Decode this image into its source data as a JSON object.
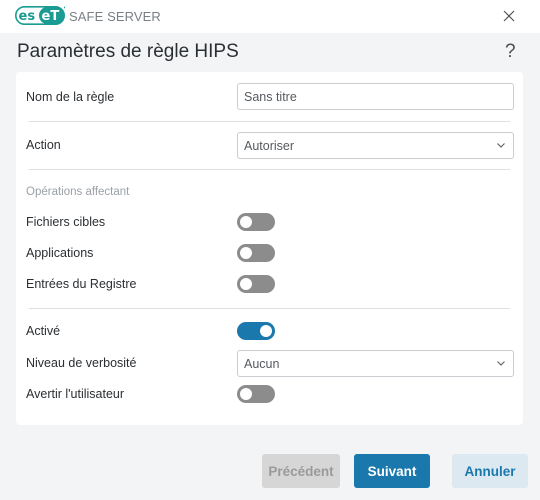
{
  "window": {
    "brand": "eset",
    "product_name": "SAFE SERVER",
    "close_icon": "close-icon"
  },
  "header": {
    "title": "Paramètres de règle HIPS",
    "help_label": "?"
  },
  "form": {
    "rule_name": {
      "label": "Nom de la règle",
      "value": "Sans titre"
    },
    "action": {
      "label": "Action",
      "selected": "Autoriser"
    },
    "operations_section": "Opérations affectant",
    "target_files": {
      "label": "Fichiers cibles",
      "enabled": false
    },
    "applications": {
      "label": "Applications",
      "enabled": false
    },
    "registry_entries": {
      "label": "Entrées du Registre",
      "enabled": false
    },
    "enabled": {
      "label": "Activé",
      "enabled": true
    },
    "verbosity": {
      "label": "Niveau de verbosité",
      "selected": "Aucun"
    },
    "notify_user": {
      "label": "Avertir l'utilisateur",
      "enabled": false
    }
  },
  "footer": {
    "previous_label": "Précédent",
    "next_label": "Suivant",
    "cancel_label": "Annuler"
  },
  "colors": {
    "accent": "#1a78ad",
    "brand_teal": "#1a9c94",
    "toggle_off": "#8c8c8c",
    "background": "#f3f4f6"
  }
}
